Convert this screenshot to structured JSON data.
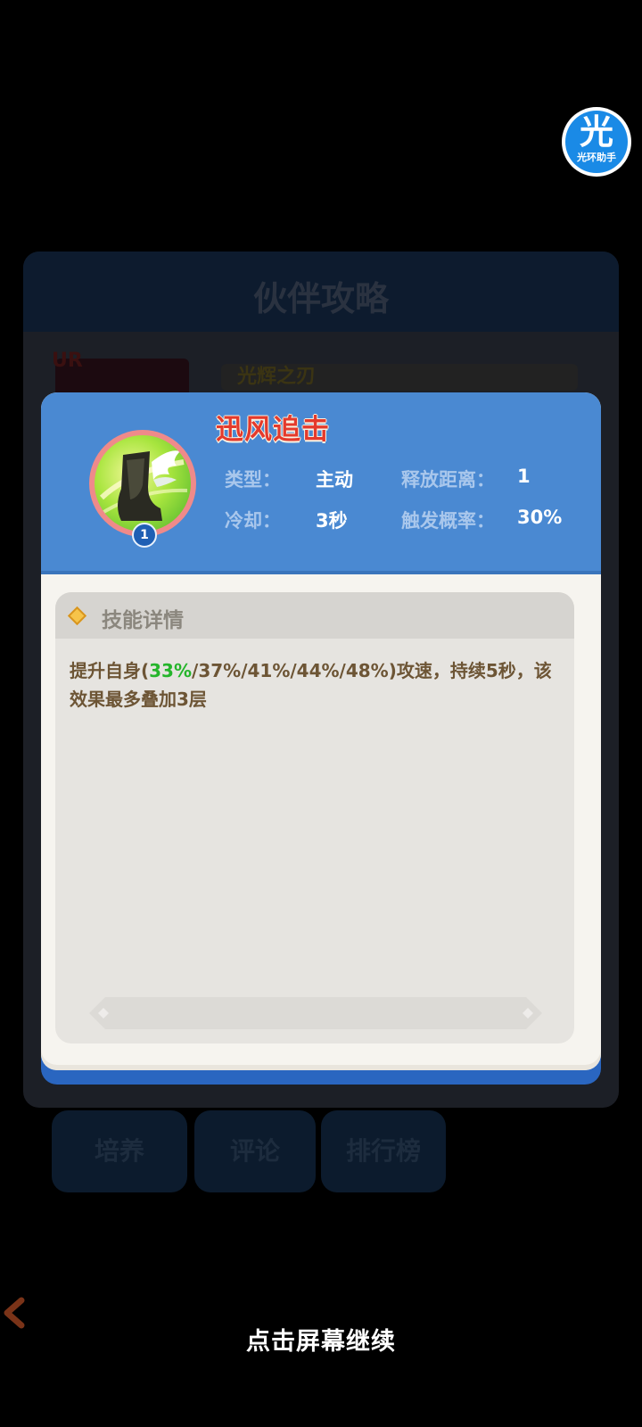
{
  "background": {
    "panel_title": "伙伴攻略",
    "rarity_badge": "UR",
    "partner_name": "光辉之刃",
    "tabs": [
      {
        "label": "培养"
      },
      {
        "label": "评论"
      },
      {
        "label": "排行榜"
      }
    ]
  },
  "assistant": {
    "glyph": "光",
    "label": "光环助手",
    "icon": "halo-assistant-icon"
  },
  "skill": {
    "name": "迅风追击",
    "level": "1",
    "icon": "winged-boot-icon",
    "stats": {
      "type_label": "类型：",
      "type_value": "主动",
      "range_label": "释放距离：",
      "range_value": "1",
      "cooldown_label": "冷却：",
      "cooldown_value": "3秒",
      "trigger_label": "触发概率：",
      "trigger_value": "30%"
    },
    "details": {
      "title": "技能详情",
      "text_prefix": "提升自身(",
      "text_highlight": "33%",
      "text_suffix": "/37%/41%/44%/48%)攻速，持续5秒，该效果最多叠加3层"
    }
  },
  "prompt": {
    "continue": "点击屏幕继续"
  },
  "colors": {
    "popup_header": "#4a89d2",
    "skill_name": "#e43a2c",
    "highlight_green": "#25b52b",
    "detail_text": "#6d5535"
  }
}
